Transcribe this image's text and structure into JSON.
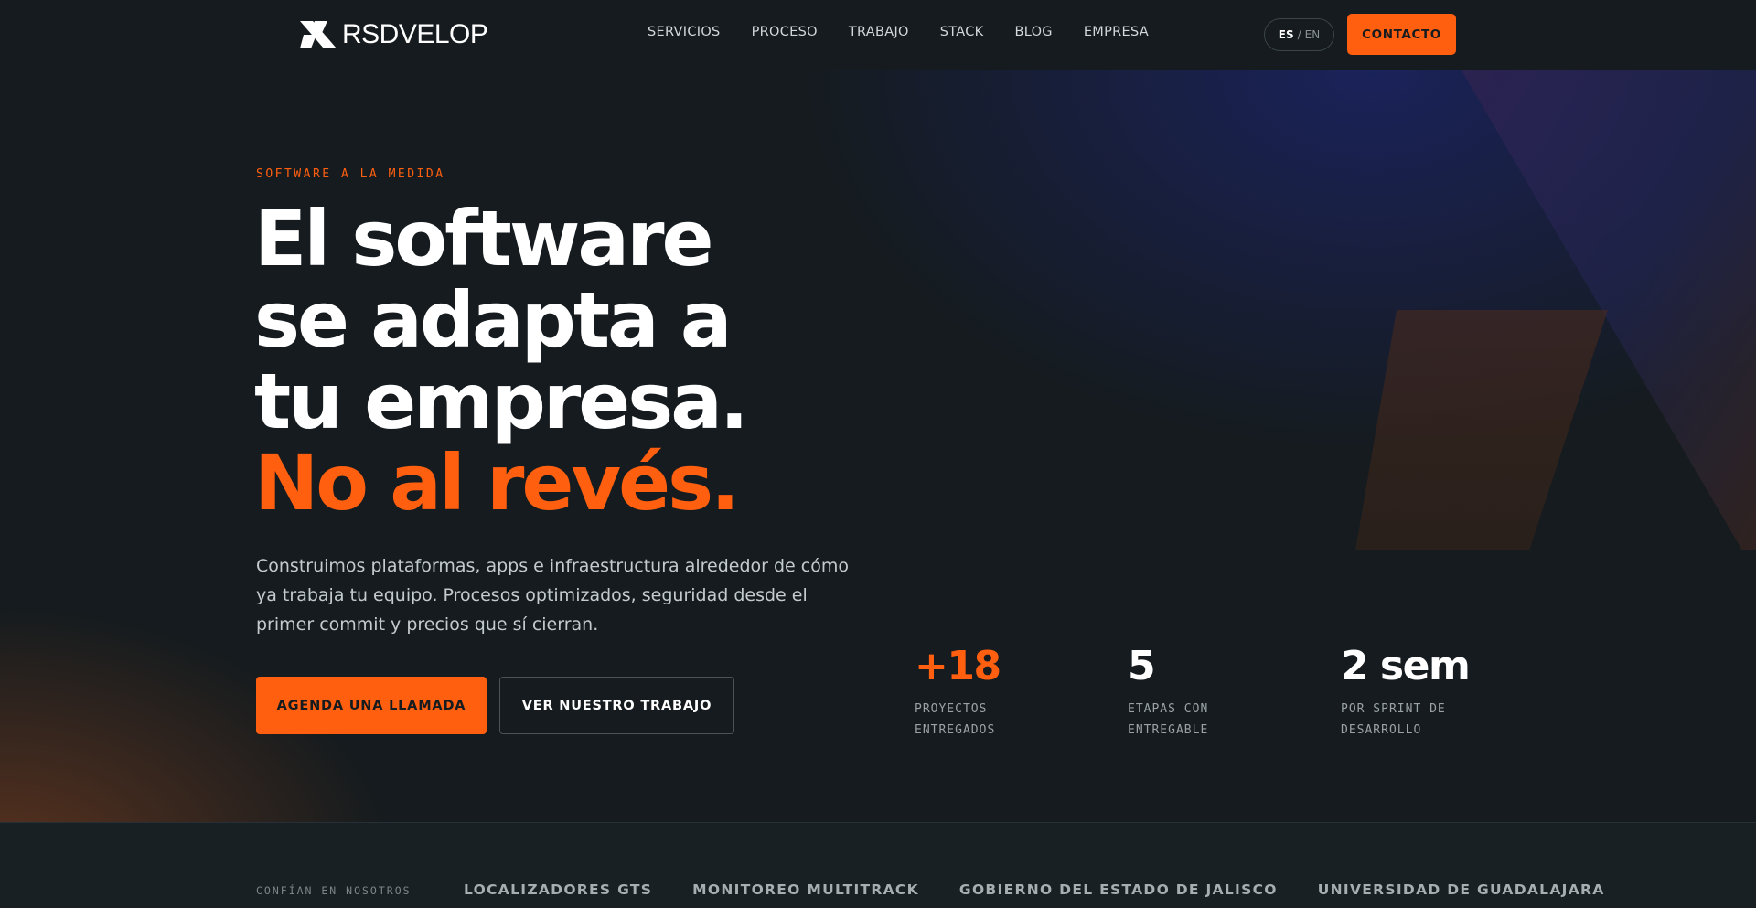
{
  "brand": {
    "name": "RSDVELOP",
    "accent_color": "#ff5f0f",
    "background_color": "#151b1e"
  },
  "nav": {
    "links": [
      "SERVICIOS",
      "PROCESO",
      "TRABAJO",
      "STACK",
      "BLOG",
      "EMPRESA"
    ],
    "lang_active": "ES",
    "lang_separator": "/",
    "lang_inactive": "EN",
    "contact_label": "CONTACTO"
  },
  "hero": {
    "eyebrow": "SOFTWARE A LA MEDIDA",
    "headline_lines": [
      "El software",
      "se adapta a",
      "tu empresa.",
      "No al revés."
    ],
    "lede": "Construimos plataformas, apps e infraestructura alrededor de cómo ya trabaja tu equipo. Procesos optimizados, seguridad desde el primer commit y precios que sí cierran.",
    "cta_primary": "AGENDA UNA LLAMADA",
    "cta_secondary": "VER NUESTRO TRABAJO"
  },
  "stats": [
    {
      "value": "+18",
      "label": "PROYECTOS ENTREGADOS",
      "accent": true
    },
    {
      "value": "5",
      "label": "ETAPAS CON ENTREGABLE",
      "accent": false
    },
    {
      "value": "2 sem",
      "label": "POR SPRINT DE DESARROLLO",
      "accent": false
    }
  ],
  "trust": {
    "label": "CONFÍAN EN NOSOTROS",
    "clients": [
      "LOCALIZADORES GTS",
      "MONITOREO MULTITRACK",
      "GOBIERNO DEL ESTADO DE JALISCO",
      "UNIVERSIDAD DE GUADALAJARA"
    ]
  }
}
